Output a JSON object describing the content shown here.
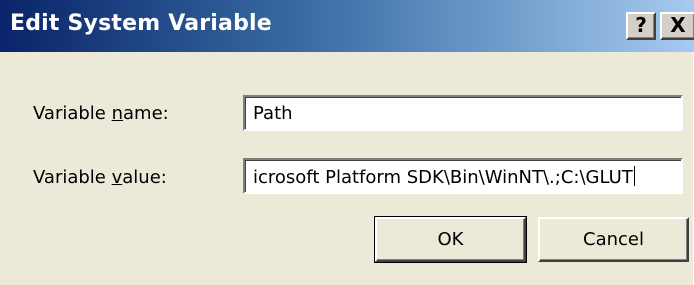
{
  "window": {
    "title": "Edit System Variable",
    "help_label": "?",
    "close_label": "X"
  },
  "form": {
    "variable_name_label_pre": "Variable ",
    "variable_name_label_accel": "n",
    "variable_name_label_post": "ame:",
    "variable_name_value": "Path",
    "variable_value_label_pre": "Variable ",
    "variable_value_label_accel": "v",
    "variable_value_label_post": "alue:",
    "variable_value_value": "icrosoft Platform SDK\\Bin\\WinNT\\.;C:\\GLUT"
  },
  "buttons": {
    "ok_label": "OK",
    "cancel_label": "Cancel"
  }
}
